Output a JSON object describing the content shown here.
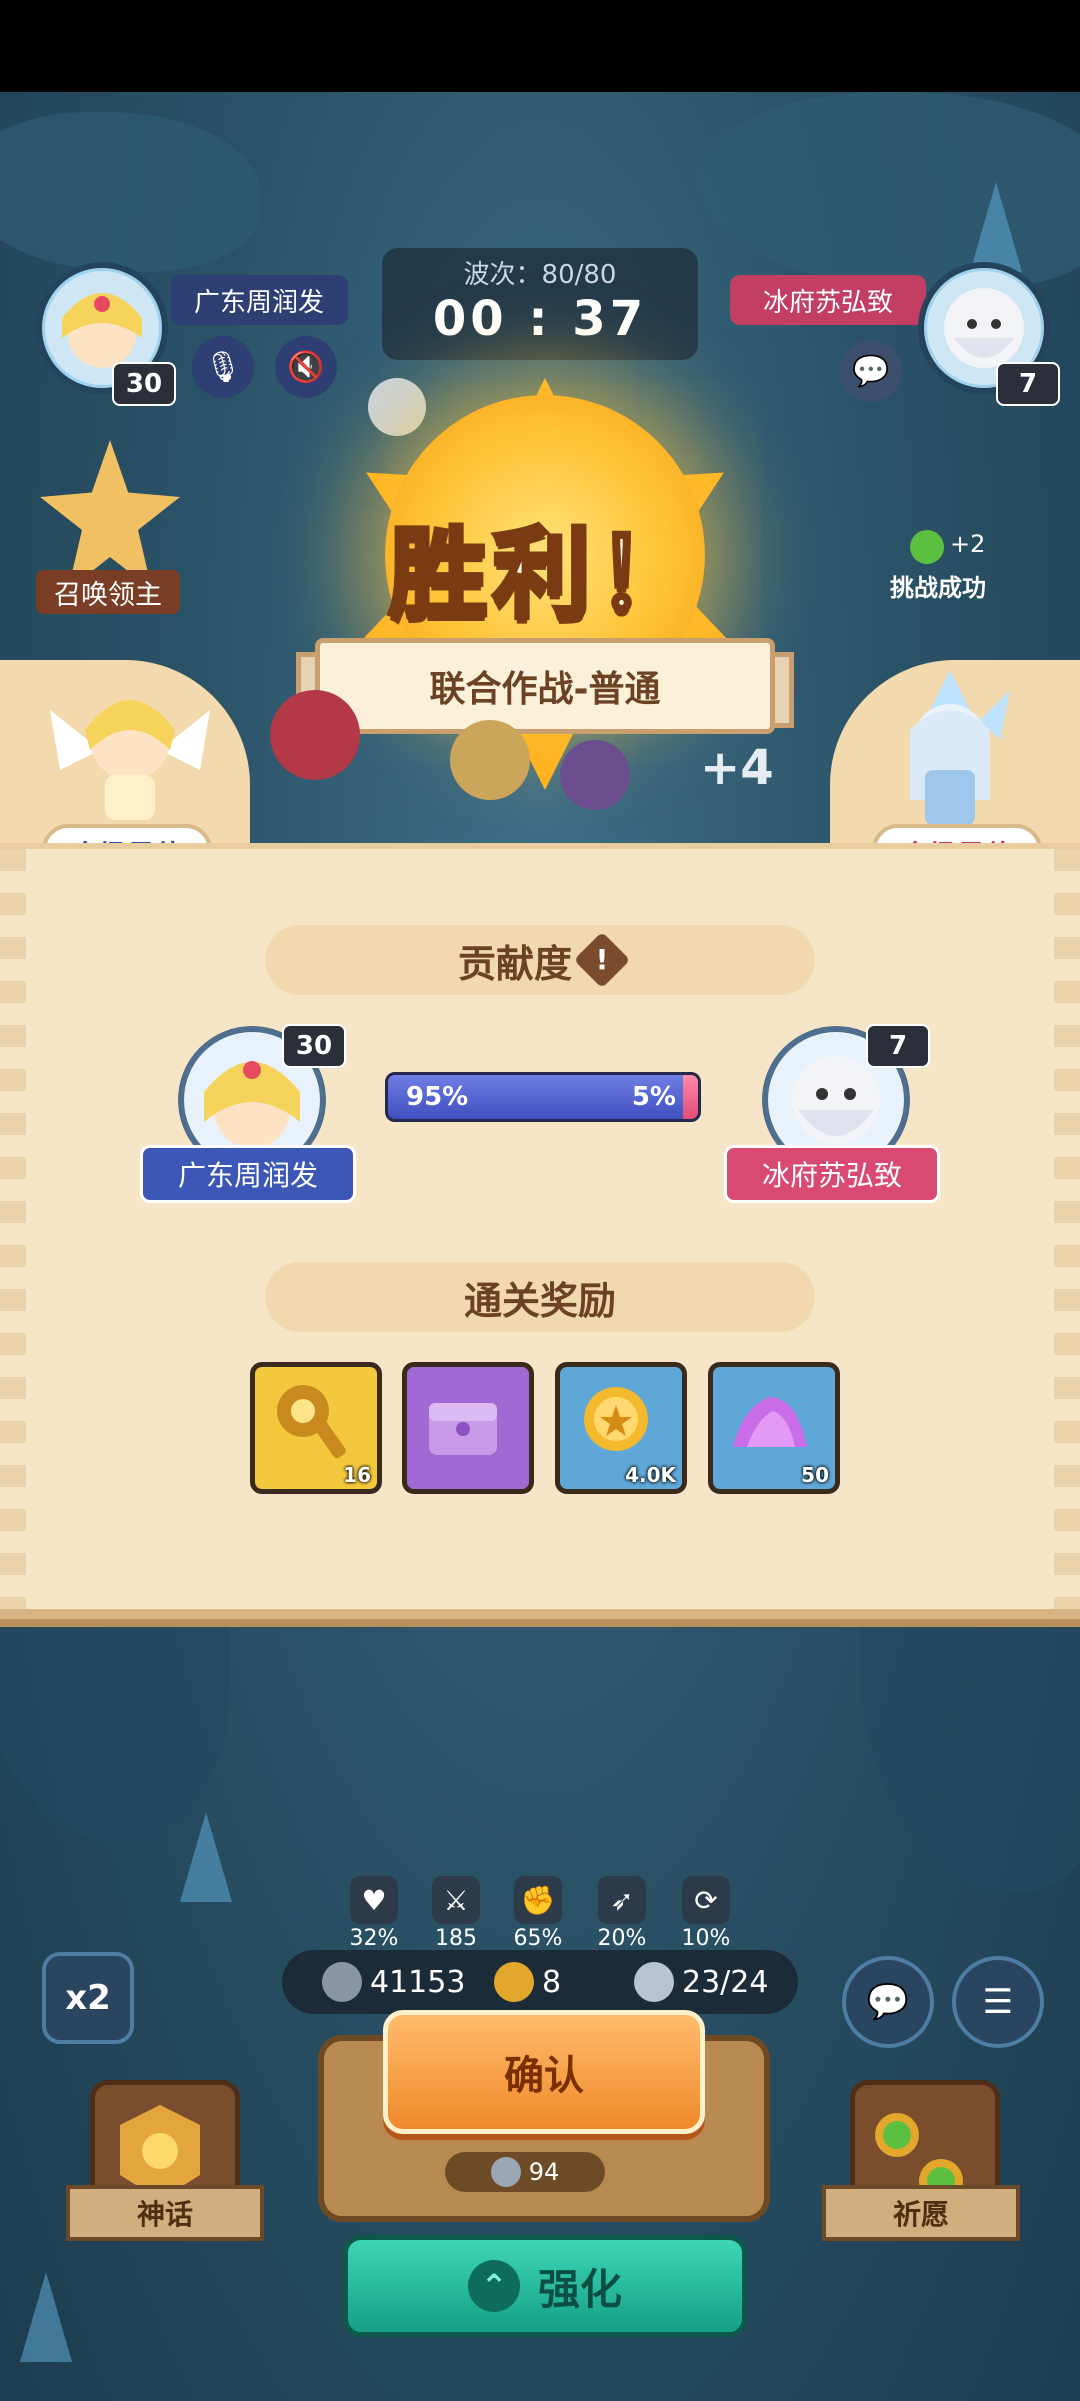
{
  "top": {
    "wave_label": "波次：80/80",
    "timer": "00 : 37",
    "left_player_name": "广东周润发",
    "left_player_level": "30",
    "right_player_name": "冰府苏弘致",
    "right_player_level": "7",
    "summon_lord_label": "召唤领主",
    "challenge_success": "挑战成功",
    "challenge_bonus": "+2",
    "extra_units": "+4"
  },
  "victory": {
    "title": "胜利！",
    "mode": "联合作战-普通",
    "mvp_left": "全场最佳",
    "mvp_right": "全场最佳"
  },
  "contribution": {
    "header": "贡献度",
    "warn_symbol": "!",
    "left_name": "广东周润发",
    "left_level": "30",
    "left_percent_value": 95,
    "left_percent": "95%",
    "right_name": "冰府苏弘致",
    "right_level": "7",
    "right_percent_value": 5,
    "right_percent": "5%"
  },
  "rewards": {
    "header": "通关奖励",
    "items": [
      {
        "icon": "key-icon",
        "count": "16",
        "color": "#f4c83c"
      },
      {
        "icon": "chest-icon",
        "count": "",
        "color": "#a069d4"
      },
      {
        "icon": "coin-icon",
        "count": "4.0K",
        "color": "#5ea7d6"
      },
      {
        "icon": "crystal-icon",
        "count": "50",
        "color": "#5ea7d6"
      }
    ]
  },
  "stats": [
    {
      "icon": "heart-crack-icon",
      "value": "32%"
    },
    {
      "icon": "sword-icon",
      "value": "185"
    },
    {
      "icon": "fist-icon",
      "value": "65%"
    },
    {
      "icon": "arrow-icon",
      "value": "20%"
    },
    {
      "icon": "speed-icon",
      "value": "10%"
    }
  ],
  "resources": {
    "silver": "41153",
    "clover": "8",
    "units": "23/24"
  },
  "buttons": {
    "speed": "x2",
    "confirm": "确认",
    "summon_cost": "94",
    "myth": "神话",
    "wish": "祈愿",
    "upgrade": "强化",
    "chat": "💬",
    "menu": "☰"
  },
  "colors": {
    "left_name_bg": "#3c57b5",
    "right_name_bg": "#d94a73",
    "bar_left": "#4f5fd0",
    "bar_right": "#e14d75"
  }
}
